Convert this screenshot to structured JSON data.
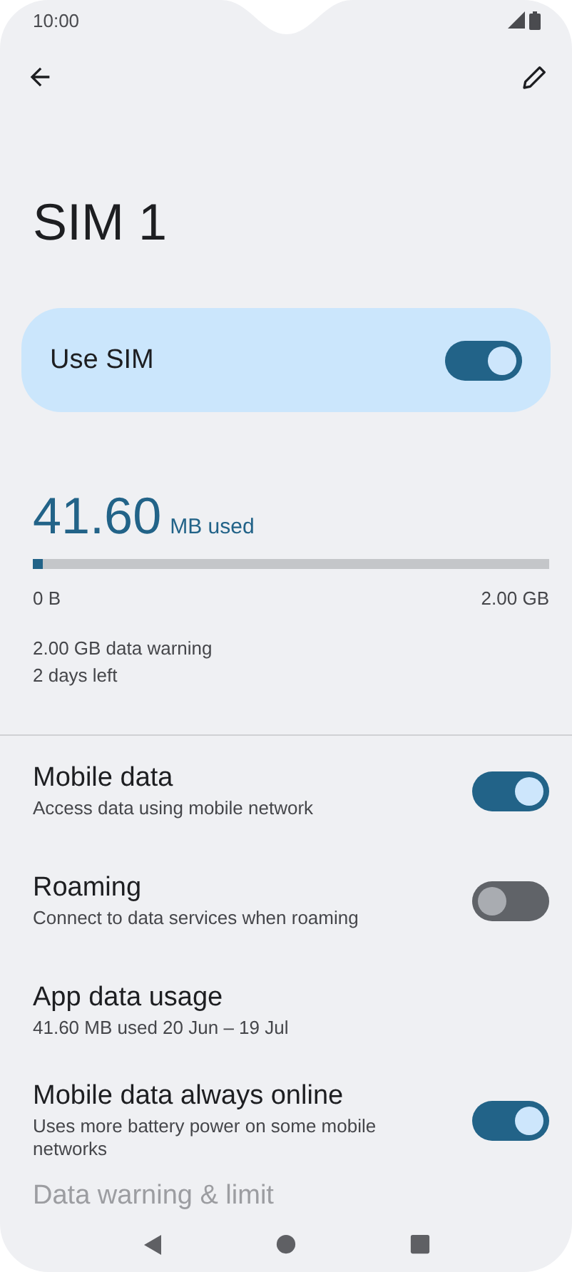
{
  "status_bar": {
    "time": "10:00"
  },
  "title": "SIM 1",
  "use_sim": {
    "label": "Use SIM",
    "on": true
  },
  "usage": {
    "amount": "41.60",
    "unit": "MB used",
    "level": 0.02,
    "min_label": "0 B",
    "max_label": "2.00 GB",
    "warning": "2.00 GB data warning",
    "days_left": "2 days left"
  },
  "settings": [
    {
      "kind": "toggle",
      "title": "Mobile data",
      "subtitle": "Access data using mobile network",
      "on": true
    },
    {
      "kind": "toggle",
      "title": "Roaming",
      "subtitle": "Connect to data services when roaming",
      "on": false
    },
    {
      "kind": "link",
      "title": "App data usage",
      "subtitle": "41.60 MB used 20 Jun – 19 Jul"
    },
    {
      "kind": "toggle",
      "title": "Mobile data always online",
      "subtitle": "Uses more battery power on some mobile networks",
      "on": true
    },
    {
      "kind": "partial",
      "title": "Data warning & limit"
    }
  ]
}
